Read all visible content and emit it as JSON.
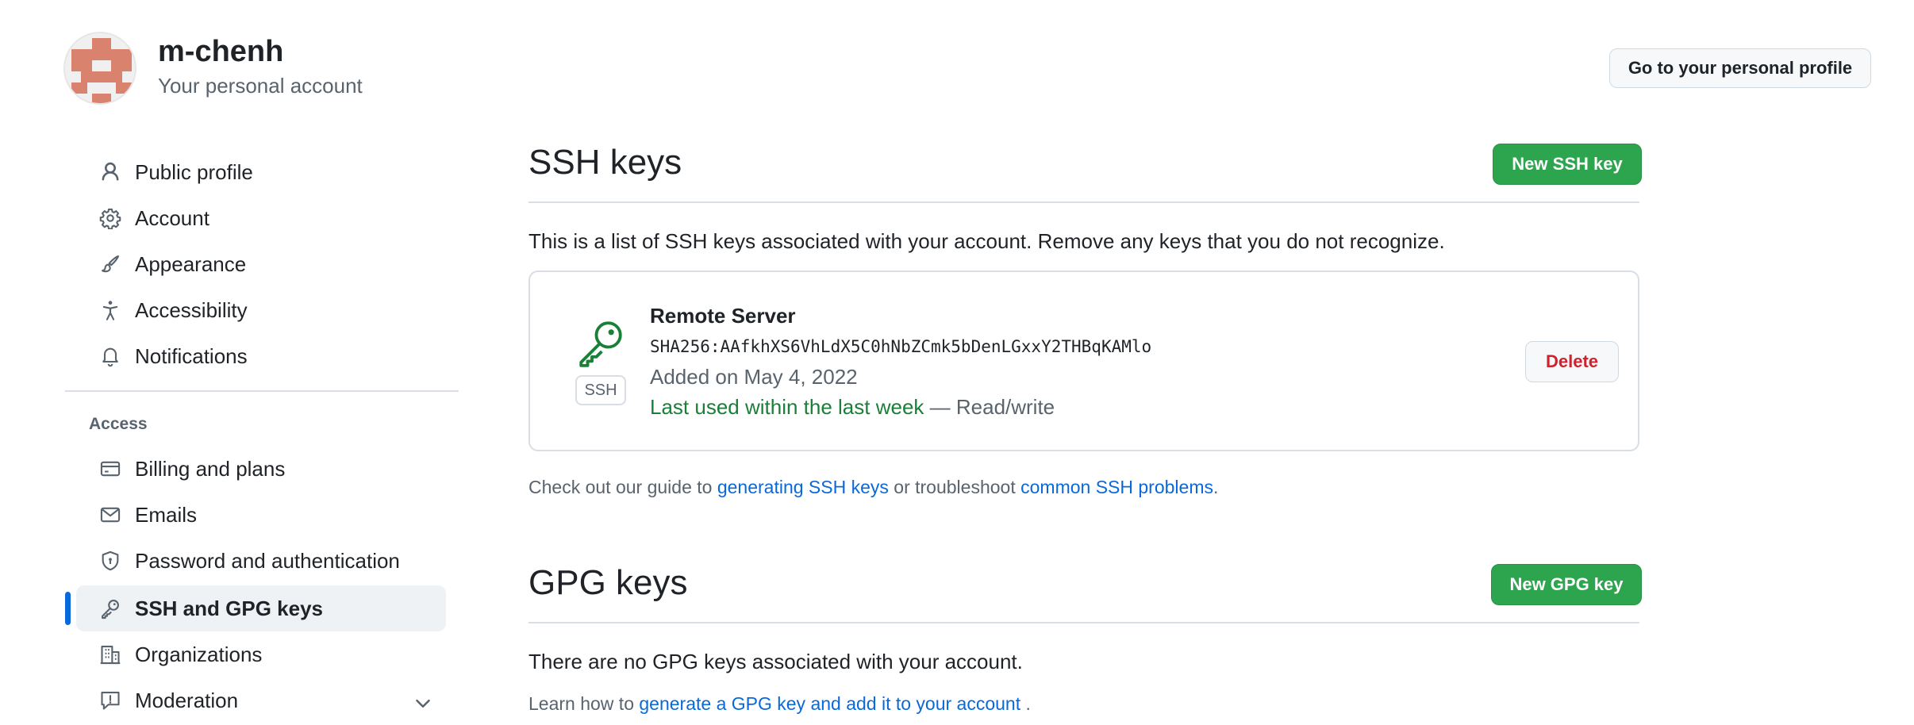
{
  "header": {
    "username": "m-chenh",
    "subtitle": "Your personal account",
    "profile_button": "Go to your personal profile"
  },
  "sidebar": {
    "items": [
      {
        "label": "Public profile",
        "icon": "person-icon"
      },
      {
        "label": "Account",
        "icon": "gear-icon"
      },
      {
        "label": "Appearance",
        "icon": "paintbrush-icon"
      },
      {
        "label": "Accessibility",
        "icon": "accessibility-icon"
      },
      {
        "label": "Notifications",
        "icon": "bell-icon"
      }
    ],
    "access_heading": "Access",
    "access_items": [
      {
        "label": "Billing and plans",
        "icon": "credit-card-icon"
      },
      {
        "label": "Emails",
        "icon": "mail-icon"
      },
      {
        "label": "Password and authentication",
        "icon": "shield-lock-icon"
      },
      {
        "label": "SSH and GPG keys",
        "icon": "key-icon",
        "active": true
      },
      {
        "label": "Organizations",
        "icon": "organization-icon"
      },
      {
        "label": "Moderation",
        "icon": "report-icon"
      }
    ]
  },
  "ssh": {
    "title": "SSH keys",
    "new_button": "New SSH key",
    "description": "This is a list of SSH keys associated with your account. Remove any keys that you do not recognize.",
    "key": {
      "badge": "SSH",
      "name": "Remote Server",
      "fingerprint": "SHA256:AAfkhXS6VhLdX5C0hNbZCmk5bDenLGxxY2THBqKAMlo",
      "added": "Added on May 4, 2022",
      "last_used": "Last used within the last week",
      "access": " — Read/write",
      "delete_button": "Delete"
    },
    "help_prefix": "Check out our guide to ",
    "help_link1": "generating SSH keys",
    "help_middle": " or troubleshoot ",
    "help_link2": "common SSH problems",
    "help_suffix": "."
  },
  "gpg": {
    "title": "GPG keys",
    "new_button": "New GPG key",
    "description": "There are no GPG keys associated with your account.",
    "help_prefix": "Learn how to ",
    "help_link": "generate a GPG key and add it to your account",
    "help_suffix": " ."
  },
  "colors": {
    "accent_blue": "#0969da",
    "primary_green": "#2da44e",
    "danger_red": "#cf222e",
    "success_text": "#1a7f37",
    "avatar_pattern": "#d9826e"
  }
}
